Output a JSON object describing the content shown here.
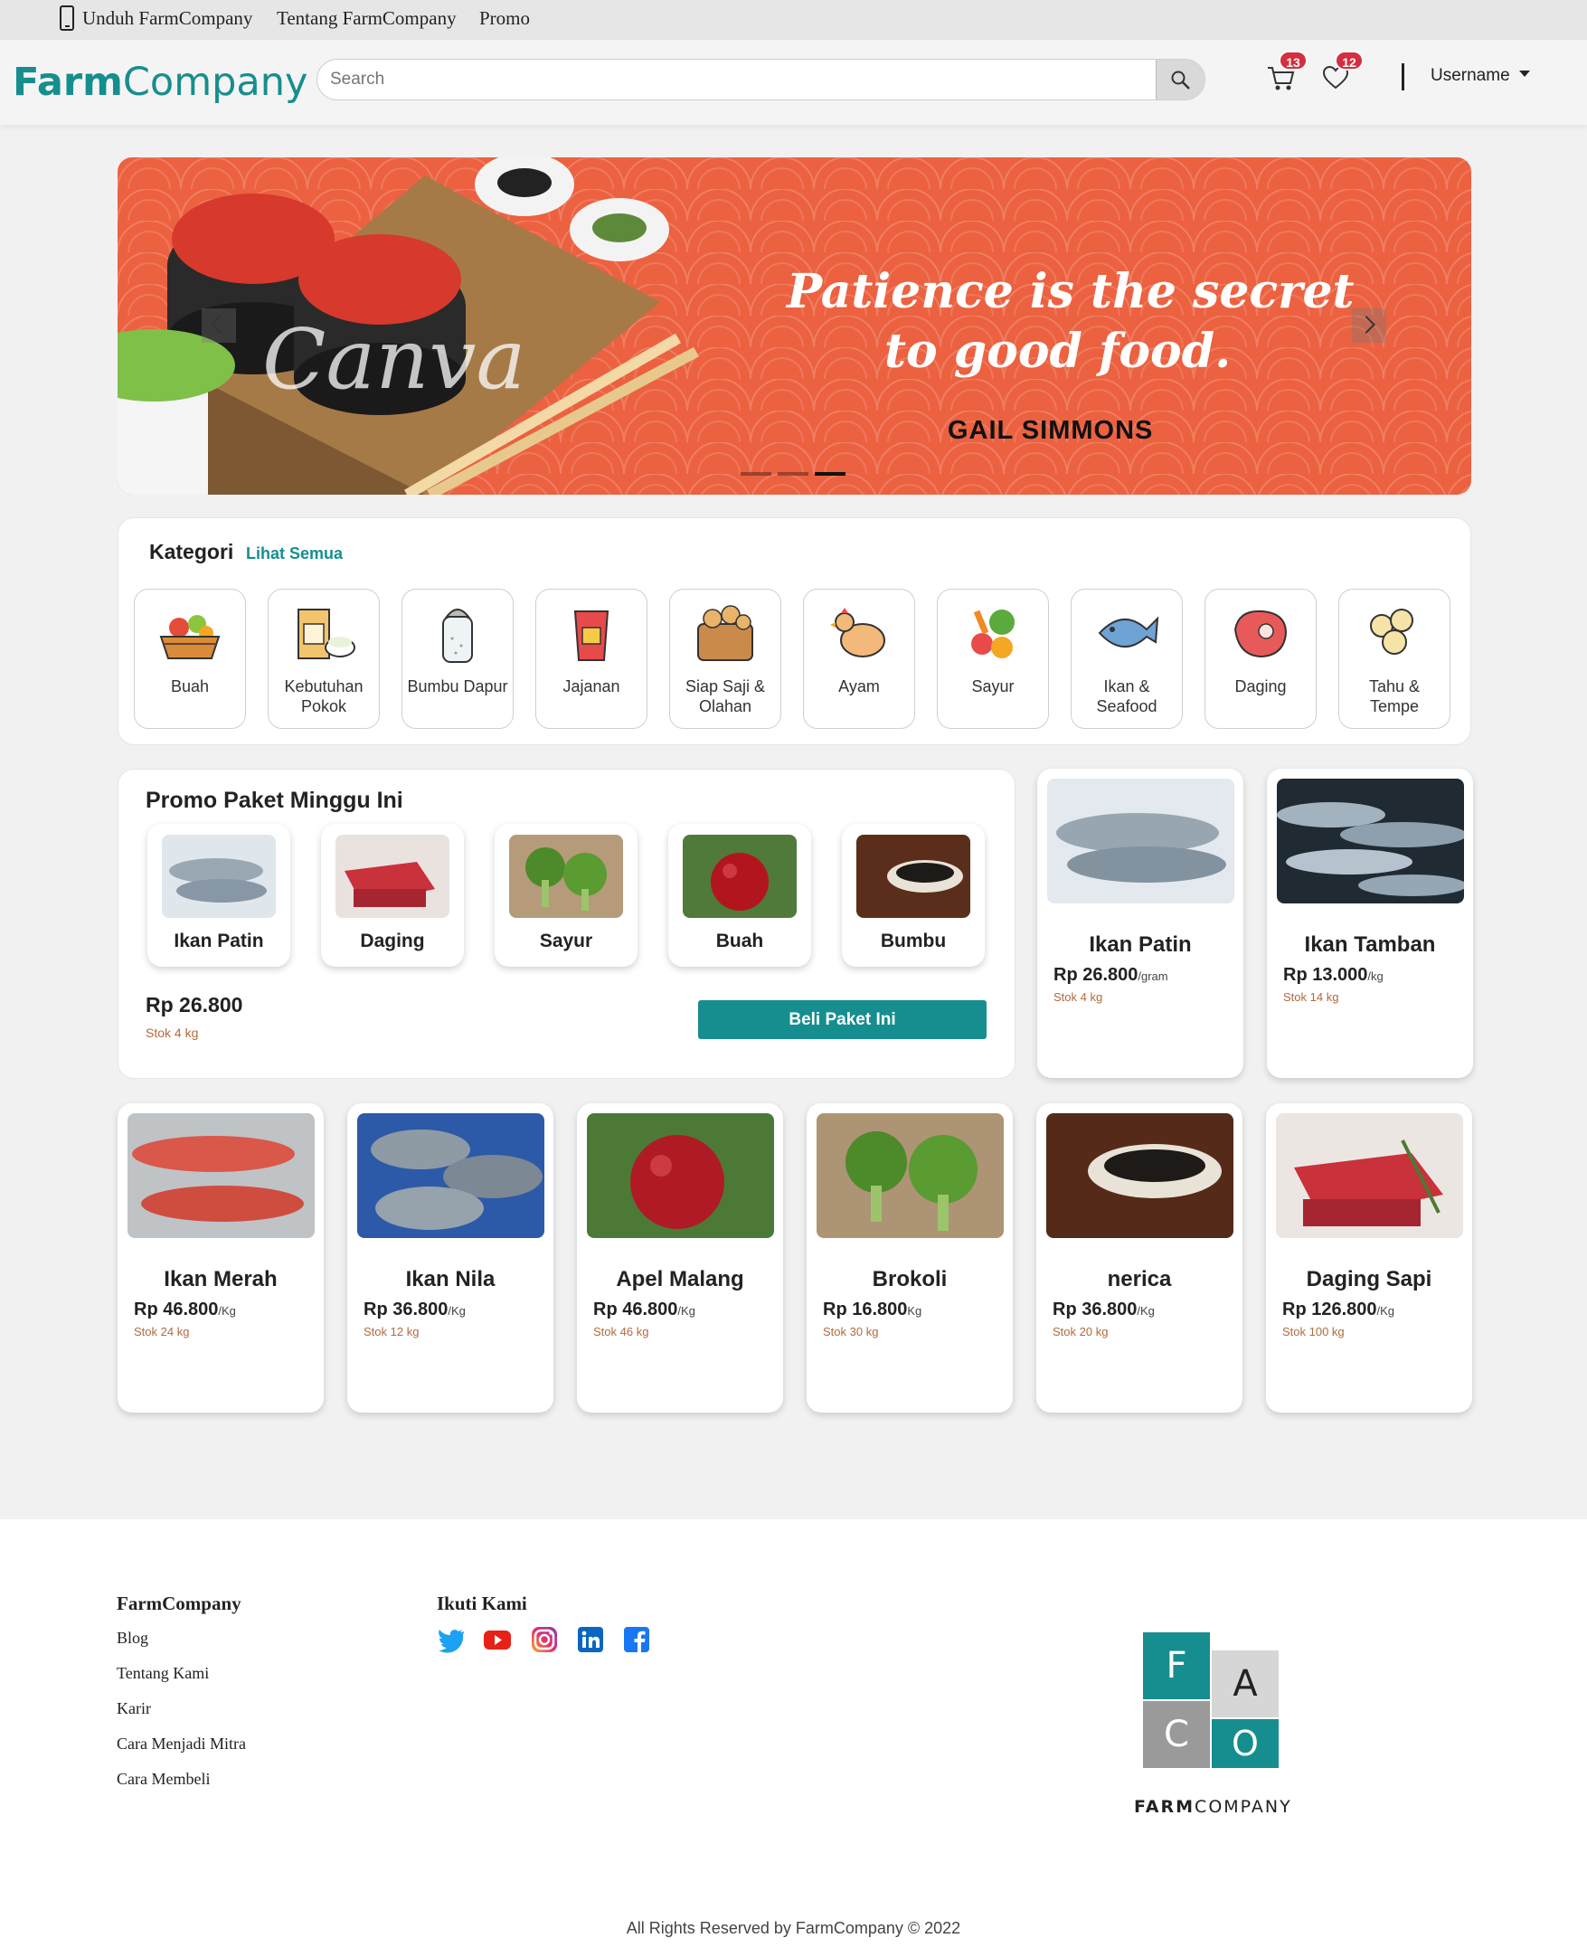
{
  "topbar": {
    "download": "Unduh FarmCompany",
    "about": "Tentang FarmCompany",
    "promo": "Promo"
  },
  "header": {
    "logo_bold": "Farm",
    "logo_rest": "Company",
    "search_placeholder": "Search",
    "cart_count": "13",
    "wishlist_count": "12",
    "username": "Username"
  },
  "banner": {
    "quote_line1": "Patience is the secret",
    "quote_line2": "to good food.",
    "author": "GAIL SIMMONS",
    "watermark": "Canva",
    "active_slide": 3,
    "slide_count": 3
  },
  "categories": {
    "title": "Kategori",
    "see_all": "Lihat Semua",
    "items": [
      {
        "label": "Buah",
        "icon": "fruit-basket-icon"
      },
      {
        "label": "Kebutuhan Pokok",
        "icon": "rice-bag-icon"
      },
      {
        "label": "Bumbu Dapur",
        "icon": "salt-shaker-icon"
      },
      {
        "label": "Jajanan",
        "icon": "snack-bag-icon"
      },
      {
        "label": "Siap Saji & Olahan",
        "icon": "food-box-icon"
      },
      {
        "label": "Ayam",
        "icon": "chicken-icon"
      },
      {
        "label": "Sayur",
        "icon": "vegetable-icon"
      },
      {
        "label": "Ikan & Seafood",
        "icon": "fish-icon"
      },
      {
        "label": "Daging",
        "icon": "meat-icon"
      },
      {
        "label": "Tahu & Tempe",
        "icon": "tofu-icon"
      }
    ]
  },
  "promo": {
    "title": "Promo Paket Minggu Ini",
    "items": [
      "Ikan Patin",
      "Daging",
      "Sayur",
      "Buah",
      "Bumbu"
    ],
    "price": "Rp 26.800",
    "stock": "Stok 4 kg",
    "buy_label": "Beli Paket Ini"
  },
  "products": [
    {
      "name": "Ikan Patin",
      "price": "Rp 26.800",
      "unit": "/gram",
      "stock": "Stok 4 kg"
    },
    {
      "name": "Ikan Tamban",
      "price": "Rp 13.000",
      "unit": "/kg",
      "stock": "Stok 14 kg"
    },
    {
      "name": "Ikan Merah",
      "price": "Rp 46.800",
      "unit": "/Kg",
      "stock": "Stok 24 kg"
    },
    {
      "name": "Ikan Nila",
      "price": "Rp 36.800",
      "unit": "/Kg",
      "stock": "Stok 12 kg"
    },
    {
      "name": "Apel Malang",
      "price": "Rp 46.800",
      "unit": "/Kg",
      "stock": "Stok 46 kg"
    },
    {
      "name": "Brokoli",
      "price": "Rp 16.800",
      "unit": "Kg",
      "stock": "Stok 30 kg"
    },
    {
      "name": "nerica",
      "price": "Rp 36.800",
      "unit": "/Kg",
      "stock": "Stok 20 kg"
    },
    {
      "name": "Daging Sapi",
      "price": "Rp 126.800",
      "unit": "/Kg",
      "stock": "Stok 100 kg"
    }
  ],
  "footer": {
    "company_title": "FarmCompany",
    "links": [
      "Blog",
      "Tentang Kami",
      "Karir",
      "Cara Menjadi Mitra",
      "Cara Membeli"
    ],
    "follow_title": "Ikuti Kami",
    "social": [
      "twitter-icon",
      "youtube-icon",
      "instagram-icon",
      "linkedin-icon",
      "facebook-icon"
    ],
    "logo_letters": [
      "F",
      "A",
      "C",
      "O"
    ],
    "logo_text_bold": "FARM",
    "logo_text_rest": "COMPANY",
    "copyright": "All Rights Reserved by FarmCompany © 2022"
  },
  "colors": {
    "brand": "#168e8f",
    "badge": "#d32f3f",
    "banner": "#ec6140",
    "stock_text": "#b06a3e"
  }
}
